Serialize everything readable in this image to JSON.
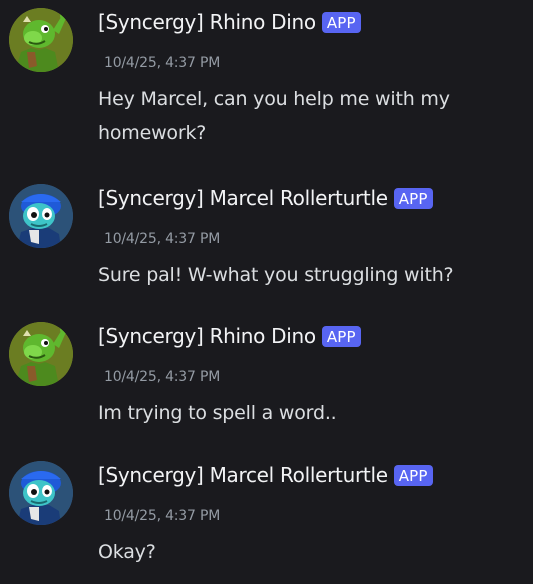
{
  "colors": {
    "background": "#1a1a1e",
    "username": "#f2f3f5",
    "app_badge": "#5865f2",
    "timestamp": "#949ba4",
    "message_text": "#dbdee1"
  },
  "messages": [
    {
      "author": "[Syncergy] Rhino Dino",
      "badge": "APP",
      "timestamp": "10/4/25, 4:37 PM",
      "text": "Hey Marcel, can you help me with my homework?",
      "avatar": "green-dinosaur-avatar-icon"
    },
    {
      "author": "[Syncergy] Marcel Rollerturtle",
      "badge": "APP",
      "timestamp": "10/4/25, 4:37 PM",
      "text": "Sure pal! W-what you struggling with?",
      "avatar": "blue-turtle-avatar-icon"
    },
    {
      "author": "[Syncergy] Rhino Dino",
      "badge": "APP",
      "timestamp": "10/4/25, 4:37 PM",
      "text": "Im trying to spell a word..",
      "avatar": "green-dinosaur-avatar-icon"
    },
    {
      "author": "[Syncergy] Marcel Rollerturtle",
      "badge": "APP",
      "timestamp": "10/4/25, 4:37 PM",
      "text": "Okay?",
      "avatar": "blue-turtle-avatar-icon"
    }
  ]
}
